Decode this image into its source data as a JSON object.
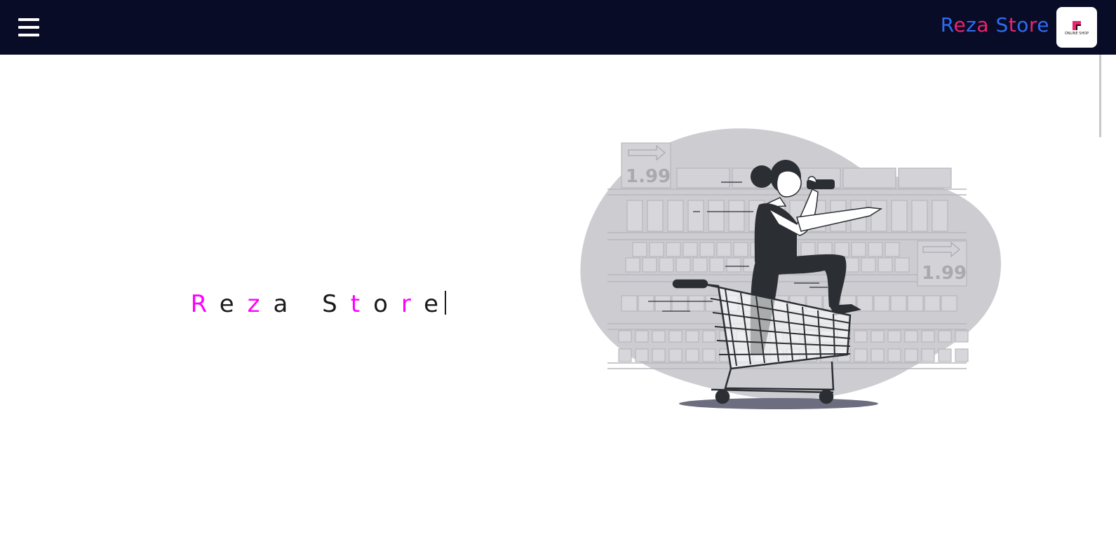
{
  "navbar": {
    "menu_icon": "hamburger-menu-icon",
    "brand_first": "Reza",
    "brand_second": "Store",
    "brand_colors": {
      "first": "#f0216f",
      "second": "#2d6cf5"
    },
    "logo": {
      "caption": "ONLINE SHOP",
      "accent": "#f0216f"
    }
  },
  "hero": {
    "title_letters": [
      "R",
      "e",
      "z",
      "a",
      " ",
      "S",
      "t",
      "o",
      "r",
      "e"
    ],
    "highlight_color": "#ff00ff",
    "illustration_icon": "shopping-cart-woman-illustration",
    "price_tags": [
      "1.99",
      "1.99"
    ]
  },
  "colors": {
    "navbar_bg": "#080c27",
    "blob": "#cdcdd1",
    "figure": "#2b2f33"
  }
}
